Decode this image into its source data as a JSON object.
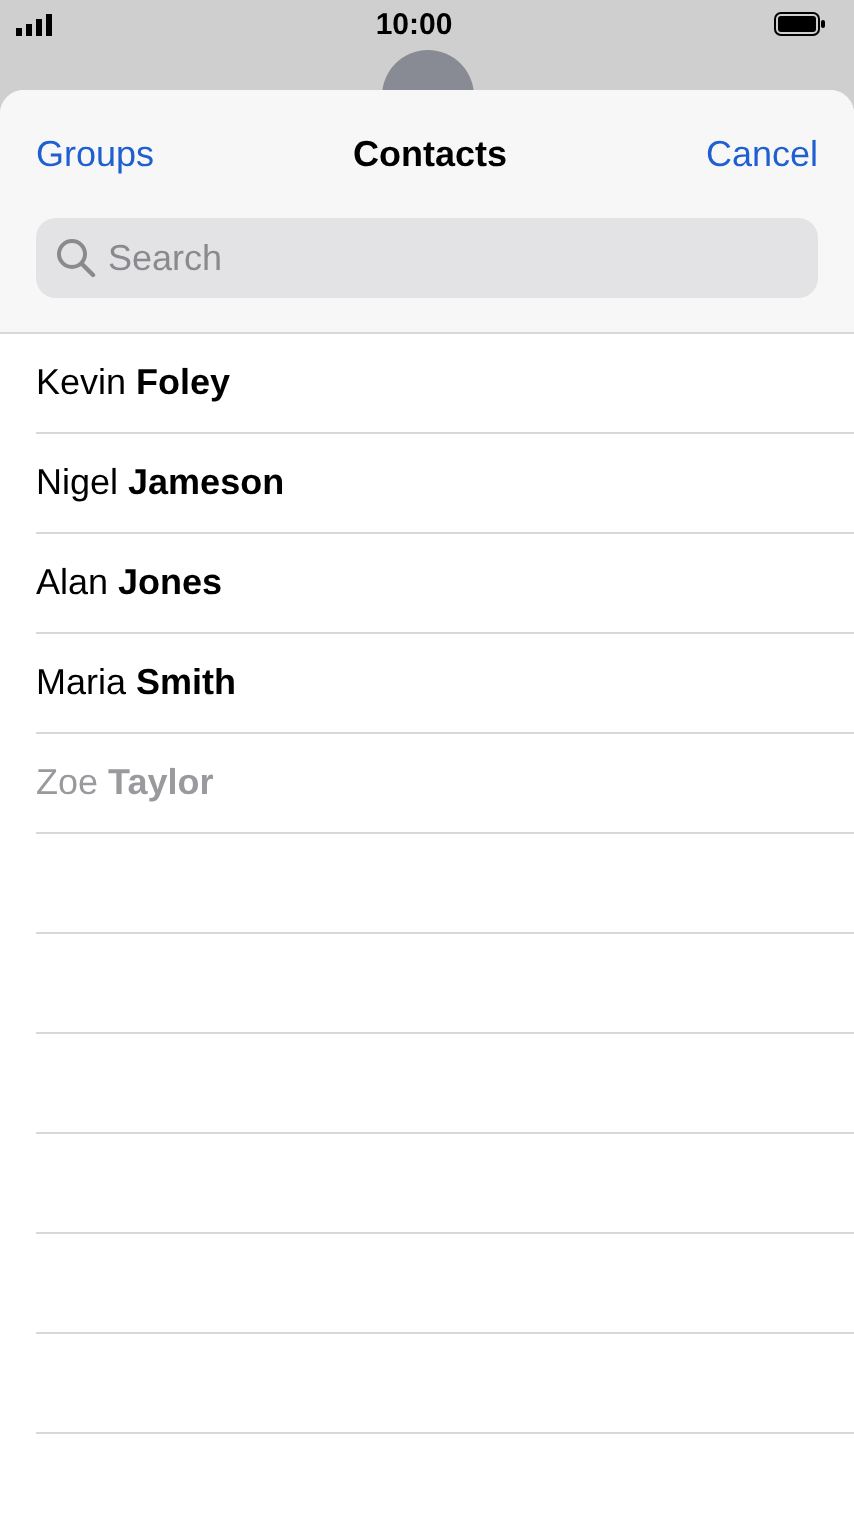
{
  "status_bar": {
    "time": "10:00"
  },
  "nav": {
    "left": "Groups",
    "title": "Contacts",
    "right": "Cancel"
  },
  "search": {
    "placeholder": "Search"
  },
  "contacts": [
    {
      "name": "Kevin **Foley**",
      "disabled": false
    },
    {
      "name": "Nigel **Jameson**",
      "disabled": false
    },
    {
      "name": "Alan **Jones**",
      "disabled": false
    },
    {
      "name": "Maria **Smith**",
      "disabled": false
    },
    {
      "name": "Zoe **Taylor**",
      "disabled": true
    }
  ]
}
